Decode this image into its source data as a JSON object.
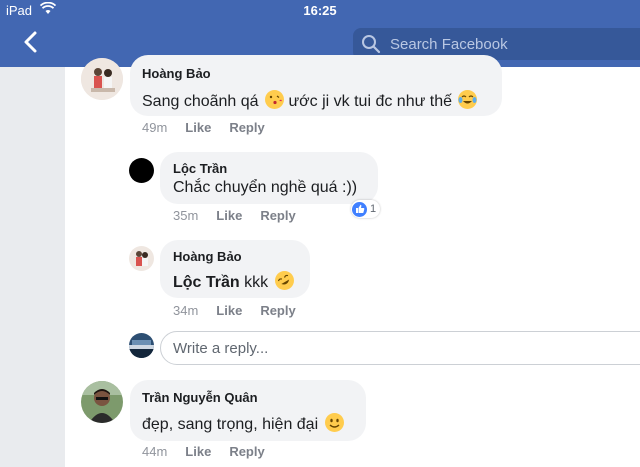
{
  "status_bar": {
    "carrier": "iPad",
    "time": "16:25"
  },
  "header": {
    "search_placeholder": "Search Facebook"
  },
  "comments": [
    {
      "author": "Hoàng Bảo",
      "text": "Sang choãnh qá",
      "text_after": "ước ji vk tui đc như thế",
      "time": "49m",
      "like": "Like",
      "reply": "Reply"
    },
    {
      "author": "Lộc Trần",
      "text": "Chắc chuyển nghề quá :))",
      "time": "35m",
      "like": "Like",
      "reply": "Reply",
      "reaction_count": "1"
    },
    {
      "author": "Hoàng Bảo",
      "mention": "Lộc Trần",
      "text": "kkk",
      "time": "34m",
      "like": "Like",
      "reply": "Reply"
    },
    {
      "author": "Trần Nguyễn Quân",
      "text": "đẹp, sang trọng, hiện đại",
      "time": "44m",
      "like": "Like",
      "reply": "Reply"
    }
  ],
  "reply_box": {
    "placeholder": "Write a reply..."
  },
  "colors": {
    "brand": "#4267b2",
    "bubble": "#f2f3f5",
    "like_blue": "#4080ff"
  }
}
